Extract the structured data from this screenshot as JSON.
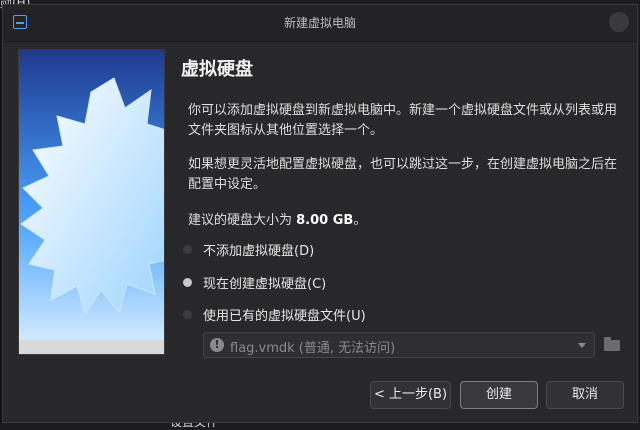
{
  "background": {
    "corner_text": "勋(H)",
    "bottom_text": "设置文件"
  },
  "window": {
    "title": "新建虚拟电脑",
    "heading": "虚拟硬盘",
    "paragraph1": "你可以添加虚拟硬盘到新虚拟电脑中。新建一个虚拟硬盘文件或从列表或用文件夹图标从其他位置选择一个。",
    "paragraph2": "如果想更灵活地配置虚拟硬盘，也可以跳过这一步，在创建虚拟电脑之后在配置中设定。",
    "recommend_prefix": "建议的硬盘大小为 ",
    "recommend_size": "8.00 GB",
    "recommend_suffix": "。",
    "options": [
      {
        "label": "不添加虚拟硬盘(D)",
        "checked": false
      },
      {
        "label": "现在创建虚拟硬盘(C)",
        "checked": true
      },
      {
        "label": "使用已有的虚拟硬盘文件(U)",
        "checked": false
      }
    ],
    "file_combo": {
      "value": "flag.vmdk (普通, 无法访问)",
      "icon": "warning-icon"
    },
    "buttons": {
      "back": "< 上一步(B)",
      "create": "创建",
      "cancel": "取消"
    }
  },
  "colors": {
    "accent": "#4aa0ff",
    "window_bg": "#28282b",
    "titlebar_bg": "#232326"
  }
}
